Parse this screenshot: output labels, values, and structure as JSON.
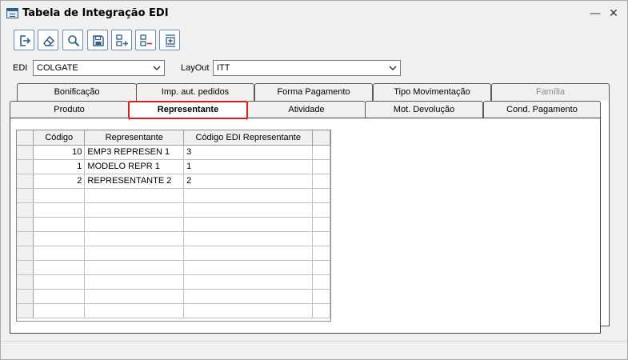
{
  "window": {
    "title": "Tabela de Integração EDI",
    "minimize_glyph": "—",
    "close_glyph": "✕"
  },
  "toolbar": {
    "buttons": [
      {
        "name": "exit-icon"
      },
      {
        "name": "eraser-icon"
      },
      {
        "name": "search-icon"
      },
      {
        "name": "save-icon"
      },
      {
        "name": "add-row-icon"
      },
      {
        "name": "remove-row-icon"
      },
      {
        "name": "insert-between-icon"
      }
    ]
  },
  "filters": {
    "edi_label": "EDI",
    "edi_value": "COLGATE",
    "layout_label": "LayOut",
    "layout_value": "ITT"
  },
  "tabs": {
    "back_row": [
      "Bonificação",
      "Imp. aut. pedidos",
      "Forma Pagamento",
      "Tipo Movimentação",
      "Família"
    ],
    "front_row": [
      "Produto",
      "Representante",
      "Atividade",
      "Mot. Devolução",
      "Cond. Pagamento"
    ],
    "active": "Representante",
    "disabled": "Família"
  },
  "grid": {
    "columns": [
      "Código",
      "Representante",
      "Código EDI Representante"
    ],
    "rows": [
      {
        "codigo": "10",
        "representante": "EMP3 REPRESEN 1",
        "codigo_edi": "3"
      },
      {
        "codigo": "1",
        "representante": "MODELO REPR 1",
        "codigo_edi": "1"
      },
      {
        "codigo": "2",
        "representante": "REPRESENTANTE 2",
        "codigo_edi": "2"
      }
    ]
  },
  "colors": {
    "highlight": "#d42020",
    "icon_blue": "#2f5d8a"
  }
}
